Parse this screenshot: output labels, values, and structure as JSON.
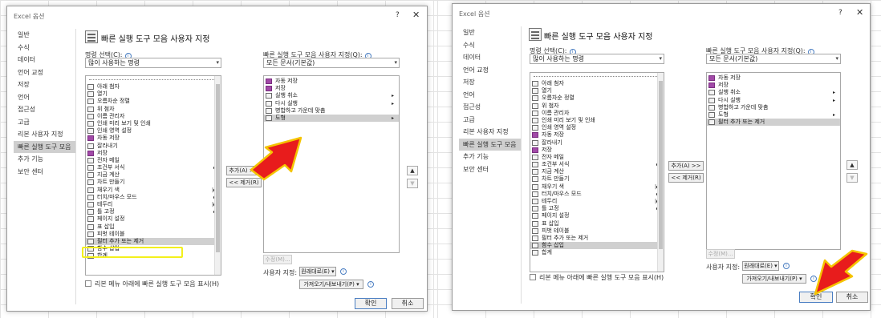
{
  "left": {
    "title": "Excel 옵션",
    "help": "?",
    "close": "✕",
    "nav": [
      "일반",
      "수식",
      "데이터",
      "언어 교정",
      "저장",
      "언어",
      "접근성",
      "고급",
      "리본 사용자 지정",
      "빠른 실행 도구 모음",
      "추가 기능",
      "보안 센터"
    ],
    "nav_active_index": 9,
    "header": "빠른 실행 도구 모음 사용자 지정",
    "choose_label": "명령 선택(C):",
    "choose_value": "많이 사용하는 명령",
    "customize_label": "빠른 실행 도구 모음 사용자 지정(Q):",
    "customize_value": "모든 문서(기본값)",
    "commands": [
      {
        "label": "아래 첨자",
        "sub": ""
      },
      {
        "label": "열기",
        "sub": ""
      },
      {
        "label": "오름차순 정렬",
        "sub": ""
      },
      {
        "label": "위 첨자",
        "sub": ""
      },
      {
        "label": "이름 관리자",
        "sub": ""
      },
      {
        "label": "인쇄 미리 보기 및 인쇄",
        "sub": ""
      },
      {
        "label": "인쇄 영역 설정",
        "sub": ""
      },
      {
        "label": "자동 저장",
        "sub": ""
      },
      {
        "label": "잘라내기",
        "sub": ""
      },
      {
        "label": "저장",
        "sub": ""
      },
      {
        "label": "전자 메일",
        "sub": ""
      },
      {
        "label": "조건부 서식",
        "sub": "▸"
      },
      {
        "label": "지금 계산",
        "sub": ""
      },
      {
        "label": "차트 만들기",
        "sub": ""
      },
      {
        "label": "채우기 색",
        "sub": "|▸"
      },
      {
        "label": "터치/마우스 모드",
        "sub": "▸"
      },
      {
        "label": "테두리",
        "sub": "|▸"
      },
      {
        "label": "틀 고정",
        "sub": "▸"
      },
      {
        "label": "페이지 설정",
        "sub": ""
      },
      {
        "label": "표 삽입",
        "sub": ""
      },
      {
        "label": "피벗 테이블",
        "sub": ""
      },
      {
        "label": "필터 추가 또는 제거",
        "sub": ""
      },
      {
        "label": "함수 삽입",
        "sub": ""
      },
      {
        "label": "합계",
        "sub": ""
      }
    ],
    "qat_items": [
      {
        "label": "자동 저장",
        "sub": ""
      },
      {
        "label": "저장",
        "sub": ""
      },
      {
        "label": "실행 취소",
        "sub": "▸"
      },
      {
        "label": "다시 실행",
        "sub": "▸"
      },
      {
        "label": "병합하고 가운데 맞춤",
        "sub": ""
      },
      {
        "label": "도형",
        "sub": "▸"
      }
    ],
    "add_button": "추가(A) >>",
    "remove_button": "<< 제거(R)",
    "modify_button": "수정(M)...",
    "customize_row_label": "사용자 지정:",
    "reset_button": "원래대로(E) ▾",
    "import_export_button": "가져오기/내보내기(P) ▾",
    "ribbon_checkbox": "리본 메뉴 아래에 빠른 실행 도구 모음 표시(H)",
    "ok_button": "확인",
    "cancel_button": "취소",
    "up_arrow": "▲",
    "down_arrow": "▼"
  },
  "right": {
    "title": "Excel 옵션",
    "help": "?",
    "close": "✕",
    "nav": [
      "일반",
      "수식",
      "데이터",
      "언어 교정",
      "저장",
      "언어",
      "접근성",
      "고급",
      "리본 사용자 지정",
      "빠른 실행 도구 모음",
      "추가 기능",
      "보안 센터"
    ],
    "nav_active_index": 9,
    "header": "빠른 실행 도구 모음 사용자 지정",
    "choose_label": "명령 선택(C):",
    "choose_value": "많이 사용하는 명령",
    "customize_label": "빠른 실행 도구 모음 사용자 지정(Q):",
    "customize_value": "모든 문서(기본값)",
    "commands": [
      {
        "label": "아래 첨자",
        "sub": ""
      },
      {
        "label": "열기",
        "sub": ""
      },
      {
        "label": "오름차순 정렬",
        "sub": ""
      },
      {
        "label": "위 첨자",
        "sub": ""
      },
      {
        "label": "이름 관리자",
        "sub": ""
      },
      {
        "label": "인쇄 미리 보기 및 인쇄",
        "sub": ""
      },
      {
        "label": "인쇄 영역 설정",
        "sub": ""
      },
      {
        "label": "자동 저장",
        "sub": ""
      },
      {
        "label": "잘라내기",
        "sub": ""
      },
      {
        "label": "저장",
        "sub": ""
      },
      {
        "label": "전자 메일",
        "sub": ""
      },
      {
        "label": "조건부 서식",
        "sub": "▸"
      },
      {
        "label": "지금 계산",
        "sub": ""
      },
      {
        "label": "차트 만들기",
        "sub": ""
      },
      {
        "label": "채우기 색",
        "sub": "|▸"
      },
      {
        "label": "터치/마우스 모드",
        "sub": "▸"
      },
      {
        "label": "테두리",
        "sub": "|▸"
      },
      {
        "label": "틀 고정",
        "sub": "▸"
      },
      {
        "label": "페이지 설정",
        "sub": ""
      },
      {
        "label": "표 삽입",
        "sub": ""
      },
      {
        "label": "피벗 테이블",
        "sub": ""
      },
      {
        "label": "필터 추가 또는 제거",
        "sub": ""
      },
      {
        "label": "함수 삽입",
        "sub": ""
      },
      {
        "label": "합계",
        "sub": ""
      }
    ],
    "qat_items": [
      {
        "label": "자동 저장",
        "sub": ""
      },
      {
        "label": "저장",
        "sub": ""
      },
      {
        "label": "실행 취소",
        "sub": "▸"
      },
      {
        "label": "다시 실행",
        "sub": "▸"
      },
      {
        "label": "병합하고 가운데 맞춤",
        "sub": ""
      },
      {
        "label": "도형",
        "sub": "▸"
      },
      {
        "label": "필터 추가 또는 제거",
        "sub": ""
      }
    ],
    "add_button": "추가(A) >>",
    "remove_button": "<< 제거(R)",
    "modify_button": "수정(M)...",
    "customize_row_label": "사용자 지정:",
    "reset_button": "원래대로(E) ▾",
    "import_export_button": "가져오기/내보내기(P) ▾",
    "ribbon_checkbox": "리본 메뉴 아래에 빠른 실행 도구 모음 표시(H)",
    "ok_button": "확인",
    "cancel_button": "취소",
    "up_arrow": "▲",
    "down_arrow": "▼"
  },
  "colors": {
    "highlight_box": "#f3f01c",
    "arrow_red": "#e81c1c",
    "arrow_outline": "#f5c400",
    "selection_gray": "#d0d0d0"
  }
}
